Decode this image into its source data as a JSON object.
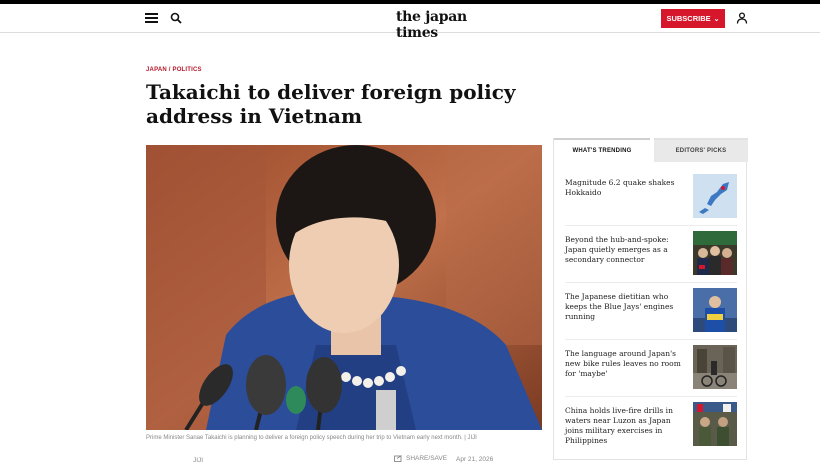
{
  "header": {
    "logo_text": "the japan times",
    "subscribe_label": "SUBSCRIBE",
    "menu_icon": "hamburger-icon",
    "search_icon": "search-icon",
    "user_icon": "user-icon",
    "subscribe_color": "#d6162b"
  },
  "article": {
    "category": "JAPAN / POLITICS",
    "headline": "Takaichi to deliver foreign policy address in Vietnam",
    "caption": "Prime Minister Sanae Takaichi is planning to deliver a foreign policy speech during her trip to Vietnam early next month. | JIJI",
    "byline": "JIJI",
    "share_label": "SHARE/SAVE",
    "date": "Apr 21, 2026",
    "category_color": "#b5172a"
  },
  "sidebar": {
    "tabs": [
      {
        "label": "WHAT'S TRENDING",
        "active": true
      },
      {
        "label": "EDITORS' PICKS",
        "active": false
      }
    ],
    "items": [
      {
        "title": "Magnitude 6.2 quake shakes Hokkaido",
        "thumb": "map-thumbnail"
      },
      {
        "title": "Beyond the hub-and-spoke: Japan quietly emerges as a secondary connector",
        "thumb": "leaders-thumbnail"
      },
      {
        "title": "The Japanese dietitian who keeps the Blue Jays' engines running",
        "thumb": "stadium-thumbnail"
      },
      {
        "title": "The language around Japan's new bike rules leaves no room for 'maybe'",
        "thumb": "street-thumbnail"
      },
      {
        "title": "China holds live-fire drills in waters near Luzon as Japan joins military exercises in Philippines",
        "thumb": "military-thumbnail"
      }
    ]
  }
}
